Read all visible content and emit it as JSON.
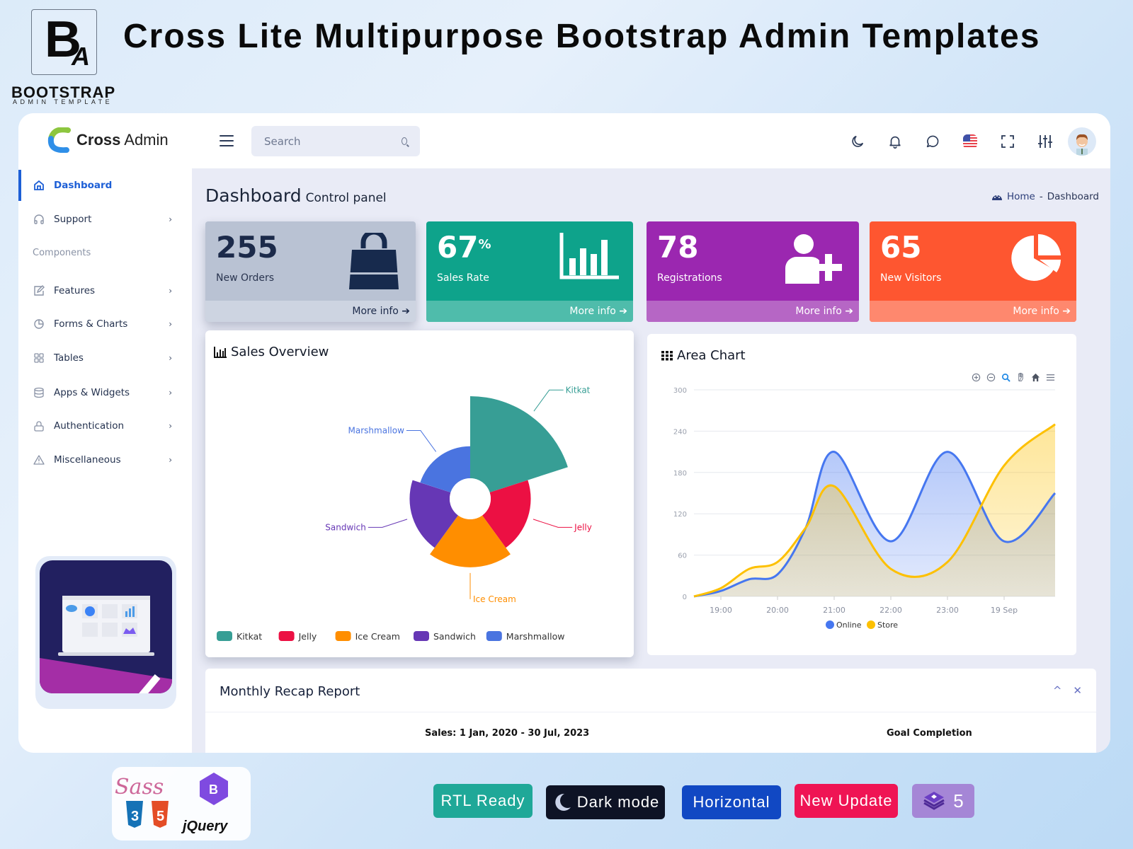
{
  "banner": {
    "brand_logo_letters": "B",
    "brand_logo_sub_letter": "A",
    "brand_name": "BOOTSTRAP",
    "brand_tagline": "ADMIN TEMPLATE",
    "title": "Cross Lite Multipurpose Bootstrap Admin Templates"
  },
  "topbar": {
    "logo_bold": "Cross",
    "logo_light": "Admin",
    "search_placeholder": "Search",
    "icons": [
      "moon-icon",
      "bell-icon",
      "chat-icon",
      "us-flag-icon",
      "fullscreen-icon",
      "settings-sliders-icon"
    ]
  },
  "sidebar": {
    "items": [
      {
        "label": "Dashboard",
        "icon": "home-icon",
        "active": true
      },
      {
        "label": "Support",
        "icon": "headphones-icon",
        "chevron": "›"
      }
    ],
    "section_label": "Components",
    "component_items": [
      {
        "label": "Features",
        "icon": "edit-icon",
        "chevron": "›"
      },
      {
        "label": "Forms & Charts",
        "icon": "pie-icon",
        "chevron": "›"
      },
      {
        "label": "Tables",
        "icon": "grid-icon",
        "chevron": "›"
      },
      {
        "label": "Apps & Widgets",
        "icon": "database-icon",
        "chevron": "›"
      },
      {
        "label": "Authentication",
        "icon": "lock-icon",
        "chevron": "›"
      },
      {
        "label": "Miscellaneous",
        "icon": "warning-icon",
        "chevron": "›"
      }
    ]
  },
  "page": {
    "title": "Dashboard",
    "subtitle": "Control panel",
    "breadcrumb": {
      "home": "Home",
      "separator": "-",
      "current": "Dashboard"
    }
  },
  "stats": [
    {
      "value": "255",
      "suffix": "",
      "label": "New Orders",
      "more": "More info ➔",
      "color": "#b9c2d3",
      "foot_color": "#cdd4e1",
      "text_color": "#1c2a4a",
      "icon": "shopping-bag-icon"
    },
    {
      "value": "67",
      "suffix": "%",
      "label": "Sales Rate",
      "more": "More info ➔",
      "color": "#0ea38b",
      "foot_color": "#4fbcab",
      "text_color": "#ffffff",
      "icon": "bar-chart-icon"
    },
    {
      "value": "78",
      "suffix": "",
      "label": "Registrations",
      "more": "More info ➔",
      "color": "#9b27b0",
      "foot_color": "#b666c5",
      "text_color": "#ffffff",
      "icon": "user-add-icon"
    },
    {
      "value": "65",
      "suffix": "",
      "label": "New Visitors",
      "more": "More info ➔",
      "color": "#fe5630",
      "foot_color": "#fe886e",
      "text_color": "#ffffff",
      "icon": "pie-chart-icon"
    }
  ],
  "sales_overview": {
    "title": "Sales Overview"
  },
  "area_chart_card": {
    "title": "Area Chart",
    "toolbar": [
      "zoom-in-icon",
      "zoom-out-icon",
      "selection-zoom-icon",
      "pan-icon",
      "reset-home-icon",
      "menu-icon"
    ]
  },
  "recap": {
    "title": "Monthly Recap Report",
    "collapse": "^",
    "close": "✕",
    "sales_range": "Sales: 1 Jan, 2020 - 30 Jul, 2023",
    "goal": "Goal Completion"
  },
  "badges": [
    {
      "label": "RTL Ready",
      "color": "#1fa898"
    },
    {
      "label": "Dark mode",
      "color": "#0e1325"
    },
    {
      "label": "Horizontal",
      "color": "#1148c3"
    },
    {
      "label": "New Update",
      "color": "#ef1454"
    },
    {
      "label": "5",
      "color": "#a586d6"
    }
  ],
  "tech_logos": [
    "Sass",
    "CSS3",
    "HTML5",
    "Bootstrap",
    "jQuery"
  ],
  "chart_data": [
    {
      "type": "pie",
      "subtype": "polar-area (nightingale rose)",
      "title": "Sales Overview",
      "categories": [
        "Kitkat",
        "Jelly",
        "Ice Cream",
        "Sandwich",
        "Marshmallow"
      ],
      "values": [
        40,
        25,
        30,
        25,
        20
      ],
      "colors": [
        "#379e95",
        "#ec1043",
        "#ff8e00",
        "#6637b5",
        "#4a74e0"
      ],
      "legend": "bottom-left"
    },
    {
      "type": "area",
      "title": "Area Chart",
      "x": [
        "18:30",
        "19:00",
        "19:30",
        "20:00",
        "20:30",
        "21:00",
        "22:00",
        "23:00",
        "19 Sep",
        "19 Sep 01:00"
      ],
      "xticks": [
        "19:00",
        "20:00",
        "21:00",
        "22:00",
        "23:00",
        "19 Sep"
      ],
      "series": [
        {
          "name": "Online",
          "color": "#4677f0",
          "values": [
            0,
            8,
            25,
            32,
            100,
            210,
            80,
            210,
            80,
            150
          ]
        },
        {
          "name": "Store",
          "color": "#fdc000",
          "values": [
            0,
            12,
            40,
            50,
            100,
            160,
            40,
            50,
            190,
            250
          ]
        }
      ],
      "ylim": [
        0,
        300
      ],
      "yticks": [
        0,
        60,
        120,
        180,
        240,
        300
      ],
      "grid": true,
      "legend": "bottom-center"
    }
  ]
}
